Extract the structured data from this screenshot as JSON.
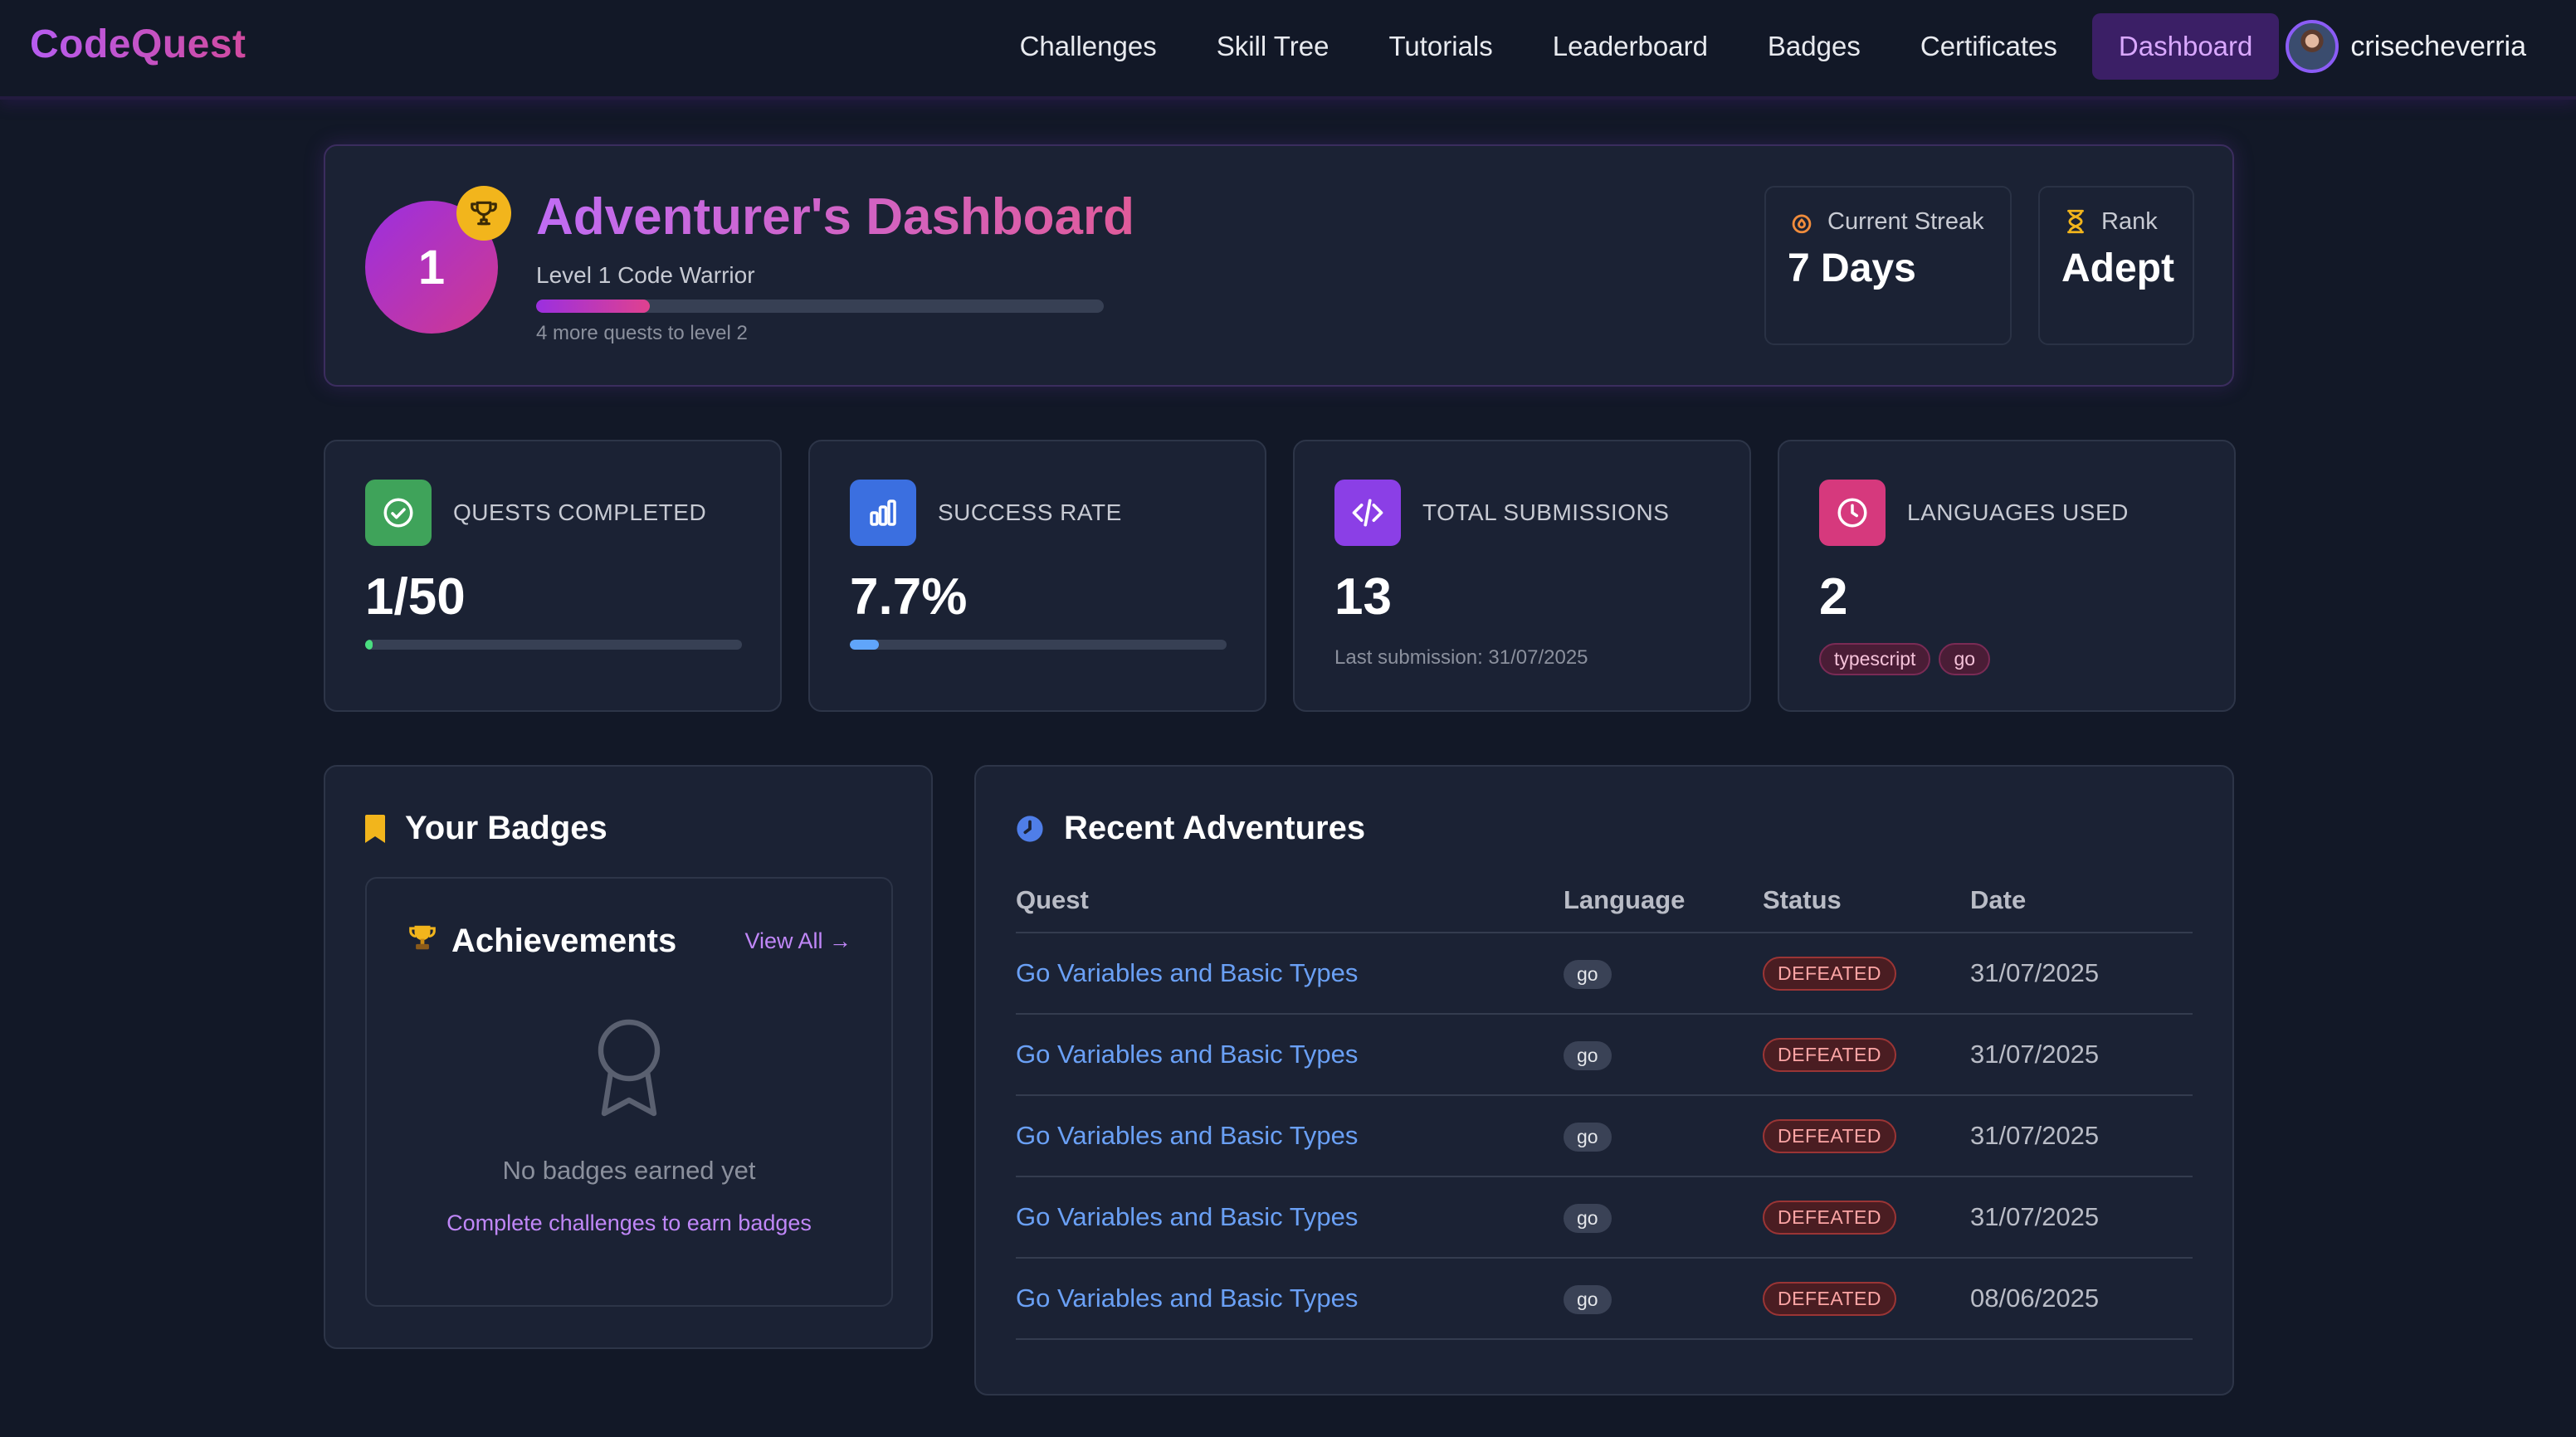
{
  "nav": {
    "brand": "CodeQuest",
    "links": [
      {
        "label": "Challenges"
      },
      {
        "label": "Skill Tree"
      },
      {
        "label": "Tutorials"
      },
      {
        "label": "Leaderboard"
      },
      {
        "label": "Badges"
      },
      {
        "label": "Certificates"
      },
      {
        "label": "Dashboard",
        "active": true
      }
    ],
    "username": "crisecheverria"
  },
  "hero": {
    "level": "1",
    "title": "Adventurer's Dashboard",
    "subtitle": "Level 1 Code Warrior",
    "progress": 0.2,
    "note": "4 more quests to level 2",
    "streak_label": "Current Streak",
    "streak_value": "7 Days",
    "rank_label": "Rank",
    "rank_value": "Adept"
  },
  "stats": {
    "quests": {
      "label": "QUESTS COMPLETED",
      "value": "1/50",
      "progress": 0.02,
      "color": "#4ade80"
    },
    "success": {
      "label": "SUCCESS RATE",
      "value": "7.7%",
      "progress": 0.077,
      "color": "#60a5fa"
    },
    "submissions": {
      "label": "TOTAL SUBMISSIONS",
      "value": "13",
      "note": "Last submission: 31/07/2025"
    },
    "languages": {
      "label": "LANGUAGES USED",
      "value": "2",
      "tags": [
        "typescript",
        "go"
      ]
    }
  },
  "badges": {
    "title": "Your Badges",
    "achievements_title": "Achievements",
    "view_all": "View All →",
    "empty_text": "No badges earned yet",
    "empty_cta": "Complete challenges to earn badges"
  },
  "recent": {
    "title": "Recent Adventures",
    "columns": [
      "Quest",
      "Language",
      "Status",
      "Date"
    ],
    "rows": [
      {
        "quest": "Go Variables and Basic Types",
        "language": "go",
        "status": "DEFEATED",
        "date": "31/07/2025"
      },
      {
        "quest": "Go Variables and Basic Types",
        "language": "go",
        "status": "DEFEATED",
        "date": "31/07/2025"
      },
      {
        "quest": "Go Variables and Basic Types",
        "language": "go",
        "status": "DEFEATED",
        "date": "31/07/2025"
      },
      {
        "quest": "Go Variables and Basic Types",
        "language": "go",
        "status": "DEFEATED",
        "date": "31/07/2025"
      },
      {
        "quest": "Go Variables and Basic Types",
        "language": "go",
        "status": "DEFEATED",
        "date": "08/06/2025"
      }
    ]
  },
  "colors": {
    "accent_purple": "#9b2fe0",
    "accent_pink": "#d0398f",
    "link_blue": "#6aa0f5",
    "status_red": "#fca5a5",
    "trophy_gold": "#f2b51c"
  },
  "icons": {
    "trophy": "trophy-icon",
    "flame": "flame-icon",
    "rank": "hourglass-icon",
    "check": "check-circle-icon",
    "chart": "bar-chart-icon",
    "code": "code-icon",
    "clock": "clock-icon",
    "bookmark": "bookmark-icon",
    "award": "award-icon"
  }
}
